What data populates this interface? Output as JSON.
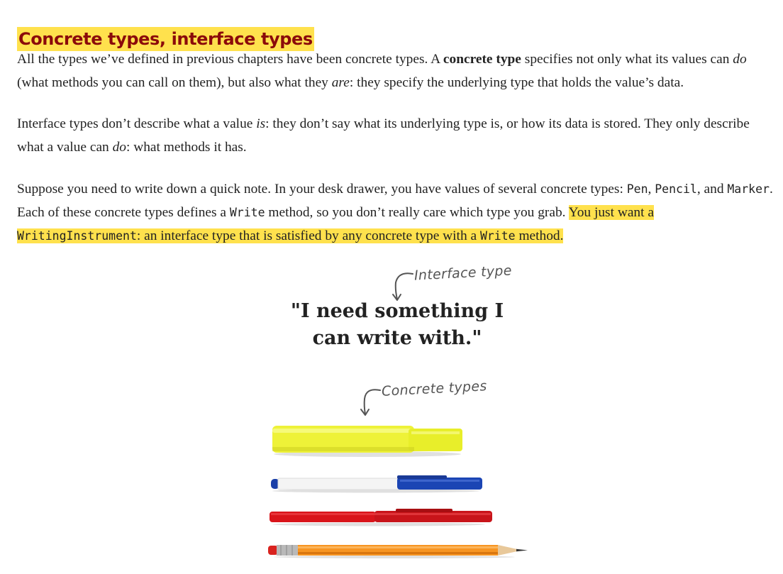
{
  "section": {
    "heading": "Concrete types, interface types"
  },
  "p1": {
    "a": "All the types we’ve defined in previous chapters have been concrete types. A ",
    "b": "concrete type",
    "c": " specifies not only what its values can ",
    "d": "do",
    "e": " (what methods you can call on them), but also what they ",
    "f": "are",
    "g": ": they specify the underlying type that holds the value’s data."
  },
  "p2": {
    "a": "Interface types don’t describe what a value ",
    "b": "is",
    "c": ": they don’t say what its underlying type is, or how its data is stored. They only describe what a value can ",
    "d": "do",
    "e": ": what methods it has."
  },
  "p3": {
    "a": "Suppose you need to write down a quick note. In your desk drawer, you have values of several concrete types: ",
    "pen": "Pen",
    "b": ", ",
    "pencil": "Pencil",
    "c": ", and ",
    "marker": "Marker",
    "d": ". Each of these concrete types defines a ",
    "write1": "Write",
    "e": " method, so you don’t really care which type you grab. ",
    "f": "You just want a ",
    "wi": "WritingInstrument",
    "g": ": an interface type that is satisfied by any concrete type with a ",
    "write2": "Write",
    "h": " method."
  },
  "figure": {
    "annotation_interface": "Interface type",
    "quote_line1": "\"I need something I",
    "quote_line2": "can write with.\"",
    "annotation_concrete": "Concrete types",
    "tools": [
      "highlighter-icon",
      "blue-pen-icon",
      "red-pen-icon",
      "pencil-icon"
    ]
  },
  "colors": {
    "heading_text": "#8b0a0a",
    "highlight": "#ffe14d"
  }
}
